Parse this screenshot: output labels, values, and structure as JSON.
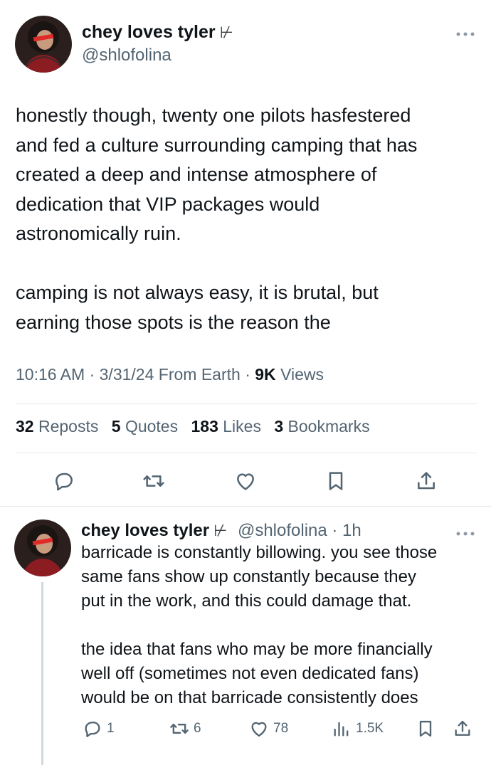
{
  "main_tweet": {
    "author": {
      "name": "chey loves tyler",
      "badge": "⊬",
      "handle": "@shlofolina"
    },
    "text": "honestly though, twenty one pilots hasfestered\nand fed a culture surrounding camping that has\ncreated a deep and intense atmosphere of\ndedication that VIP packages would\nastronomically ruin.\n\ncamping is not always easy, it is brutal, but\nearning those spots is the reason the",
    "meta": {
      "time": "10:16 AM",
      "date": "3/31/24",
      "location": "From Earth",
      "views_count": "9K",
      "views_label": "Views"
    },
    "stats": {
      "reposts_count": "32",
      "reposts_label": "Reposts",
      "quotes_count": "5",
      "quotes_label": "Quotes",
      "likes_count": "183",
      "likes_label": "Likes",
      "bookmarks_count": "3",
      "bookmarks_label": "Bookmarks"
    },
    "actions": [
      "reply-icon",
      "repost-icon",
      "like-icon",
      "bookmark-icon",
      "share-icon"
    ]
  },
  "reply_tweet": {
    "author": {
      "name": "chey loves tyler",
      "badge": "⊬",
      "handle": "@shlofolina",
      "time": "1h"
    },
    "text": "barricade is constantly billowing. you see those\nsame fans show up constantly because they\nput in the work, and this could damage that.\n\nthe idea that fans who may be more financially\nwell off (sometimes not even dedicated fans)\nwould be on that barricade consistently does",
    "actions": {
      "replies": "1",
      "reposts": "6",
      "likes": "78",
      "views": "1.5K"
    }
  },
  "colors": {
    "text": "#0f1419",
    "secondary": "#536471",
    "divider": "#e3e7ea",
    "thread_line": "#cfd9de"
  }
}
